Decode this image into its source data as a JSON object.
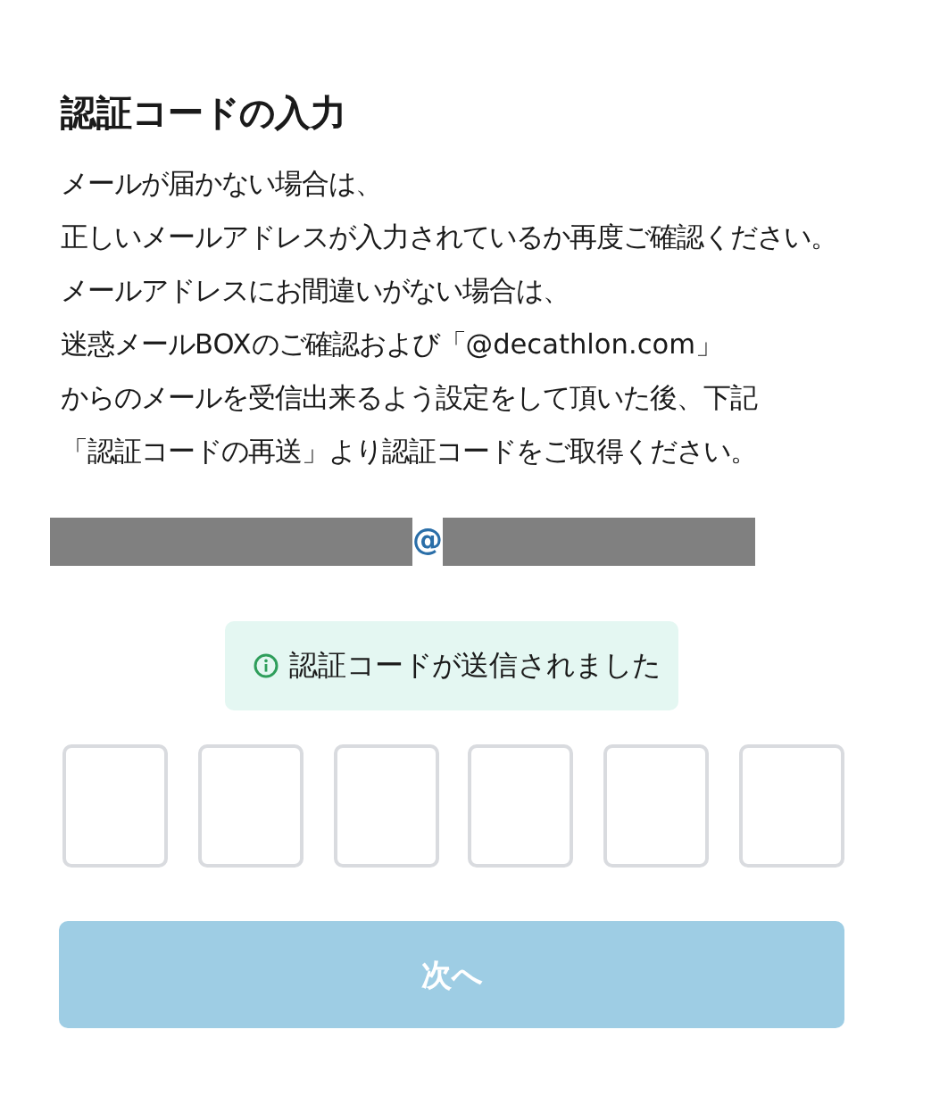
{
  "title": "認証コードの入力",
  "description_lines": [
    "メールが届かない場合は、",
    "正しいメールアドレスが入力されているか再度ご確認ください。",
    "メールアドレスにお間違いがない場合は、",
    "迷惑メールBOXのご確認および「@decathlon.com」",
    "からのメールを受信出来るよう設定をして頂いた後、下記",
    "「認証コードの再送」より認証コードをご取得ください。"
  ],
  "email": {
    "local_redacted": true,
    "separator": "@",
    "domain_redacted": true
  },
  "notice": {
    "kind": "success",
    "text": "認証コードが送信されました"
  },
  "code_fields": [
    {
      "focused": false
    },
    {
      "focused": false
    },
    {
      "focused": false
    },
    {
      "focused": false
    },
    {
      "focused": false
    },
    {
      "focused": false
    }
  ],
  "next_button": {
    "label": "次へ",
    "disabled": true
  }
}
